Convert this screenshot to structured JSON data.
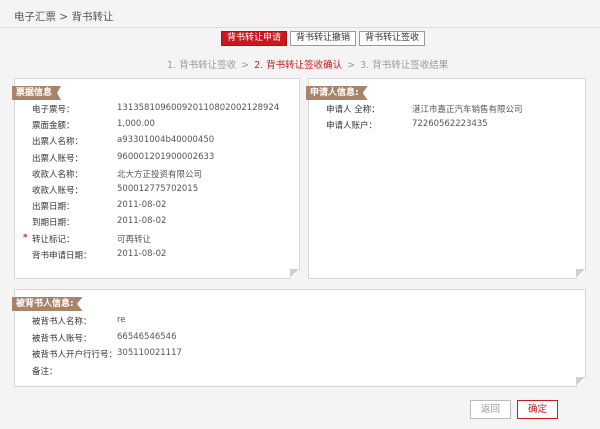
{
  "breadcrumb": "电子汇票 > 背书转让",
  "tabs": [
    {
      "label": "背书转让申请",
      "active": true
    },
    {
      "label": "背书转让撤销",
      "active": false
    },
    {
      "label": "背书转让签收",
      "active": false
    }
  ],
  "steps": [
    {
      "label": "1. 背书转让签收"
    },
    {
      "label": "2. 背书转让签收确认",
      "current": true
    },
    {
      "label": "3. 背书转让签收结果"
    }
  ],
  "step_separator": ">",
  "bill_info": {
    "title": "票据信息",
    "rows": [
      {
        "label": "电子票号：",
        "value": "131358109600920110802002128924"
      },
      {
        "label": "票面金额：",
        "value": "1,000.00"
      },
      {
        "label": "出票人名称：",
        "value": "a93301004b40000450"
      },
      {
        "label": "出票人账号：",
        "value": "960001201900002633"
      },
      {
        "label": "收款人名称：",
        "value": "北大方正投资有限公司"
      },
      {
        "label": "收款人账号：",
        "value": "500012775702015"
      },
      {
        "label": "出票日期：",
        "value": "2011-08-02"
      },
      {
        "label": "到期日期：",
        "value": "2011-08-02"
      },
      {
        "label": "转让标记：",
        "value": "可再转让",
        "required": "*"
      },
      {
        "label": "背书申请日期：",
        "value": "2011-08-02"
      }
    ]
  },
  "applicant_info": {
    "title": "申请人信息:",
    "rows": [
      {
        "label": "申请人 全称：",
        "value": "湛江市嘉正汽车销售有限公司"
      },
      {
        "label": "申请人账户：",
        "value": "72260562223435"
      }
    ]
  },
  "endorsee_info": {
    "title": "被背书人信息:",
    "rows": [
      {
        "label": "被背书人名称：",
        "value": "re"
      },
      {
        "label": "被背书人账号：",
        "value": "66546546546"
      },
      {
        "label": "被背书人开户行行号：",
        "value": "305110021117"
      },
      {
        "label": "备注：",
        "value": ""
      }
    ]
  },
  "buttons": {
    "back": "返回",
    "confirm": "确定"
  },
  "colors": {
    "accent": "#c8191f",
    "tag": "#a8836a"
  }
}
